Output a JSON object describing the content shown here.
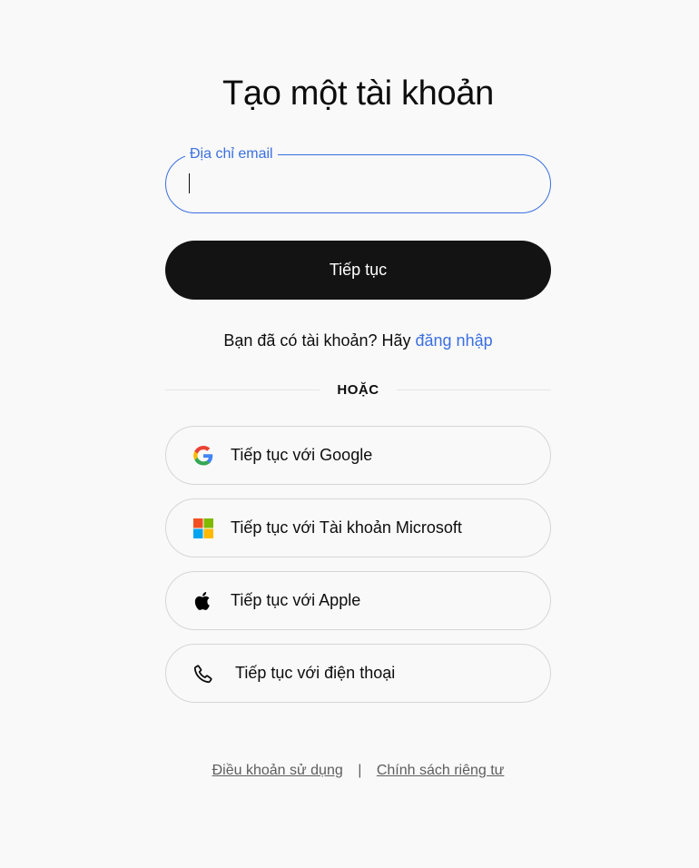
{
  "page": {
    "title": "Tạo một tài khoản"
  },
  "email": {
    "label": "Địa chỉ email",
    "value": "",
    "placeholder": ""
  },
  "continue_button": {
    "label": "Tiếp tục"
  },
  "login_prompt": {
    "text": "Bạn đã có tài khoản? Hãy ",
    "link": "đăng nhập"
  },
  "divider": {
    "text": "HOẶC"
  },
  "social": [
    {
      "label": "Tiếp tục với Google",
      "icon": "google-icon"
    },
    {
      "label": "Tiếp tục với Tài khoản Microsoft",
      "icon": "microsoft-icon"
    },
    {
      "label": "Tiếp tục với Apple",
      "icon": "apple-icon"
    },
    {
      "label": "Tiếp tục với điện thoại",
      "icon": "phone-icon"
    }
  ],
  "footer": {
    "terms": "Điều khoản sử dụng",
    "separator": "|",
    "privacy": "Chính sách riêng tư"
  },
  "colors": {
    "accent": "#3b6fe0",
    "primary_button": "#131313",
    "background": "#f9f9f9",
    "border": "#d6d6d6"
  }
}
